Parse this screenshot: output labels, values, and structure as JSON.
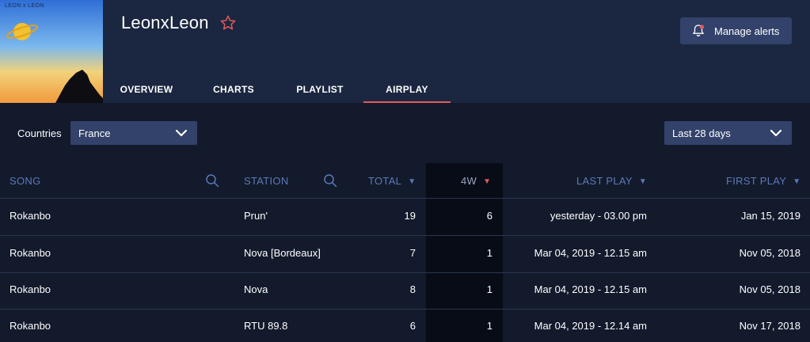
{
  "cover": {
    "text": "LEON x LEON"
  },
  "artist": {
    "name": "LeonxLeon"
  },
  "alerts": {
    "label": "Manage alerts"
  },
  "tabs": [
    {
      "label": "OVERVIEW",
      "active": false
    },
    {
      "label": "CHARTS",
      "active": false
    },
    {
      "label": "PLAYLIST",
      "active": false
    },
    {
      "label": "AIRPLAY",
      "active": true
    }
  ],
  "filters": {
    "countries_label": "Countries",
    "country_value": "France",
    "period_value": "Last 28 days"
  },
  "table": {
    "headers": {
      "song": "SONG",
      "station": "STATION",
      "total": "TOTAL",
      "fourw": "4W",
      "last_play": "LAST PLAY",
      "first_play": "FIRST PLAY"
    },
    "rows": [
      {
        "song": "Rokanbo",
        "station": "Prun'",
        "total": "19",
        "fourw": "6",
        "last_play": "yesterday - 03.00 pm",
        "first_play": "Jan 15, 2019"
      },
      {
        "song": "Rokanbo",
        "station": "Nova [Bordeaux]",
        "total": "7",
        "fourw": "1",
        "last_play": "Mar 04, 2019 - 12.15 am",
        "first_play": "Nov 05, 2018"
      },
      {
        "song": "Rokanbo",
        "station": "Nova",
        "total": "8",
        "fourw": "1",
        "last_play": "Mar 04, 2019 - 12.15 am",
        "first_play": "Nov 05, 2018"
      },
      {
        "song": "Rokanbo",
        "station": "RTU 89.8",
        "total": "6",
        "fourw": "1",
        "last_play": "Mar 04, 2019 - 12.14 am",
        "first_play": "Nov 17, 2018"
      }
    ]
  },
  "colors": {
    "header_bg": "#1b2740",
    "page_bg": "#121a2c",
    "accent": "#e35a5a",
    "header_text": "#5d79b8",
    "control_bg": "#33426a"
  },
  "icons": [
    "star-icon",
    "bell-icon",
    "chevron-down-icon",
    "search-icon",
    "sort-arrow-icon"
  ]
}
